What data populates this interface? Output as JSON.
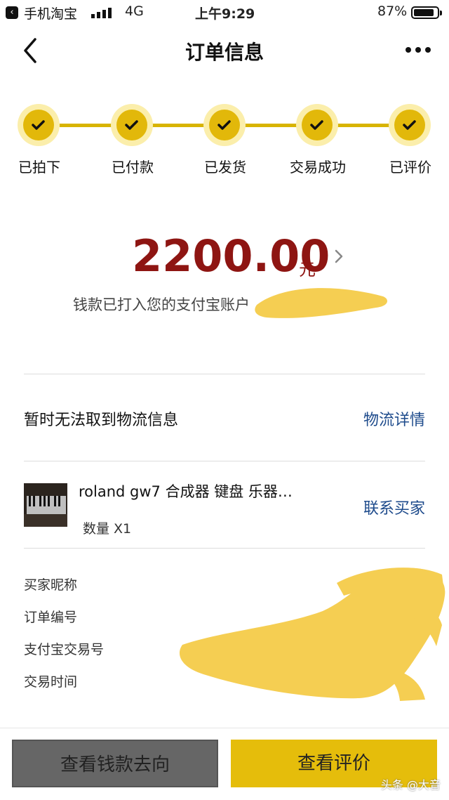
{
  "status_bar": {
    "back_app": "手机淘宝",
    "network": "4G",
    "time": "上午9:29",
    "battery_pct": "87%",
    "battery_level": 0.87
  },
  "nav": {
    "title": "订单信息"
  },
  "steps": [
    {
      "label": "已拍下",
      "done": true
    },
    {
      "label": "已付款",
      "done": true
    },
    {
      "label": "已发货",
      "done": true
    },
    {
      "label": "交易成功",
      "done": true
    },
    {
      "label": "已评价",
      "done": true
    }
  ],
  "amount": {
    "value": "2200.00",
    "unit": "元",
    "note": "钱款已打入您的支付宝账户"
  },
  "logistics": {
    "status": "暂时无法取到物流信息",
    "link": "物流详情"
  },
  "product": {
    "name": "roland gw7 合成器 键盘 乐器…",
    "quantity": "数量 X1",
    "contact": "联系买家"
  },
  "order_info": {
    "labels": [
      "买家昵称",
      "订单编号",
      "支付宝交易号",
      "交易时间"
    ]
  },
  "buttons": {
    "money_flow": "查看钱款去向",
    "rate": "查看评价"
  },
  "watermark": "头条 @大音",
  "colors": {
    "accent_yellow": "#e2b80a",
    "step_halo": "#fbeeab",
    "amount_red": "#8e1512",
    "link_blue": "#1e4b8c",
    "button_gray": "#666666"
  }
}
